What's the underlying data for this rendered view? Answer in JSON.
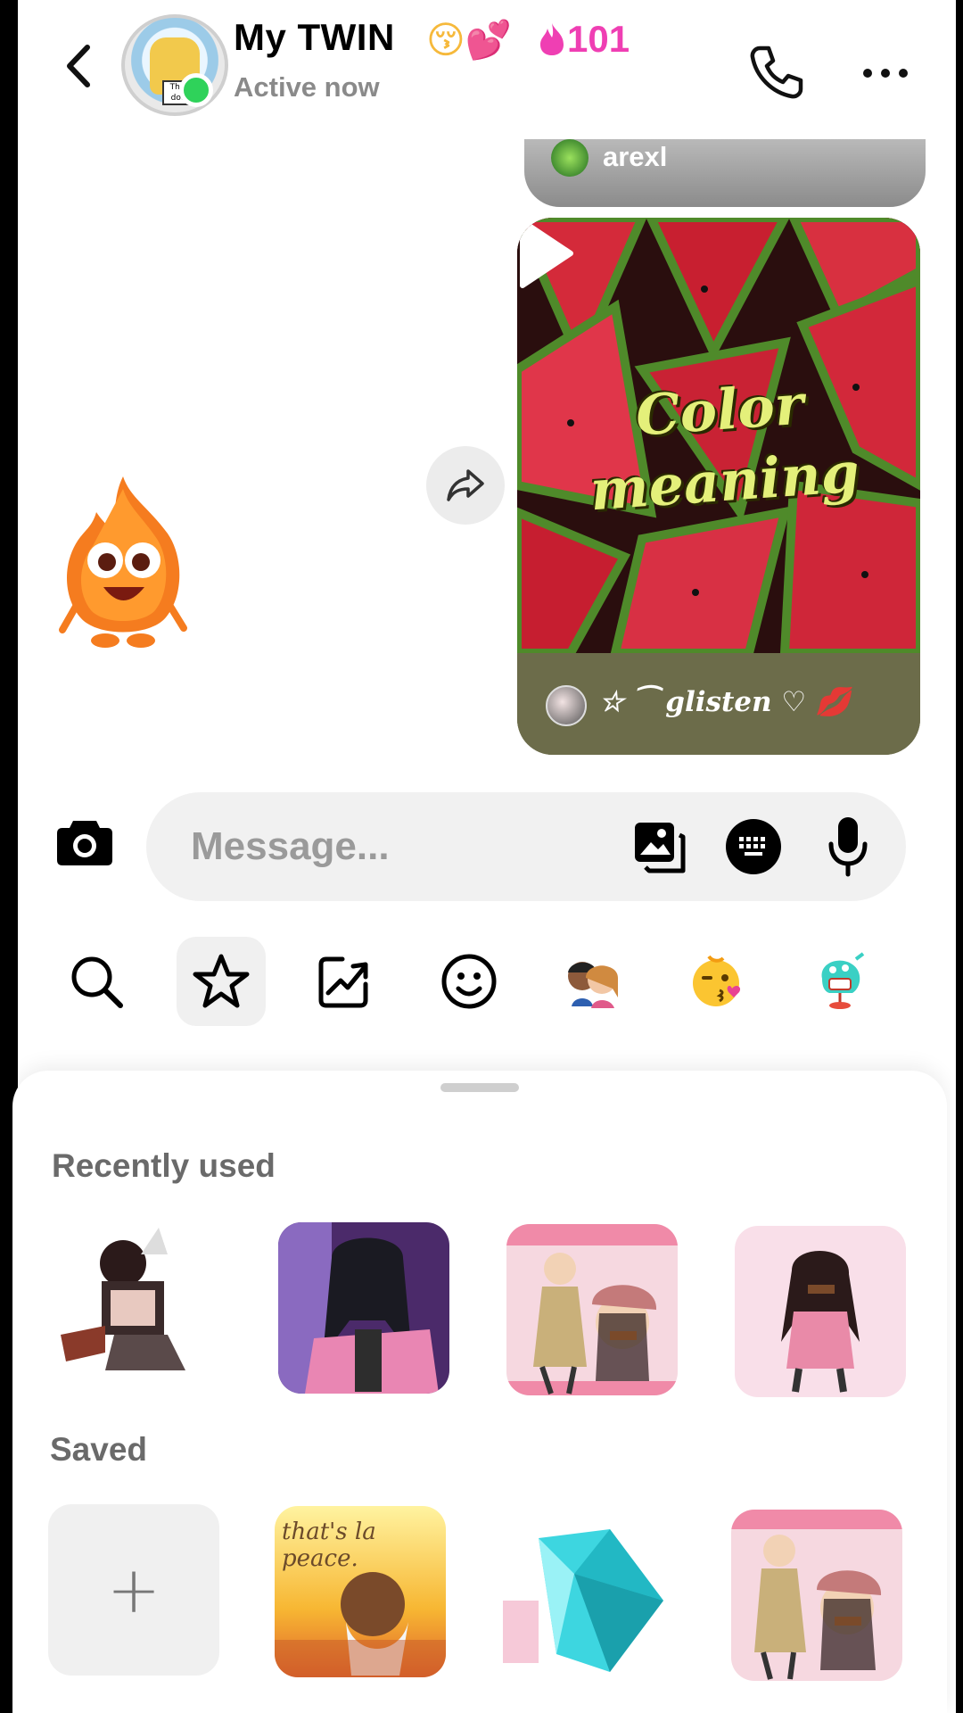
{
  "header": {
    "contact_name": "My TWIN",
    "contact_emoji": "😚💕",
    "streak_count": "101",
    "status": "Active now",
    "icons": [
      "back-icon",
      "phone-icon",
      "more-icon"
    ]
  },
  "messages": {
    "reply_username": "arexl",
    "video_title": "Color meaning",
    "video_caption": "☆ ⁀ glisten ♡ 💋",
    "share_icon": "share-icon",
    "play_icon": "play-icon",
    "sticker": "fire-mascot"
  },
  "composer": {
    "placeholder": "Message...",
    "icons": [
      "camera-icon",
      "gallery-icon",
      "keyboard-icon",
      "microphone-icon"
    ]
  },
  "sticker_tabs": [
    "search-icon",
    "star-icon",
    "trending-icon",
    "smiley-icon",
    "avatars-icon",
    "kiss-emoji-icon",
    "character-icon"
  ],
  "sticker_sheet": {
    "recently_used_label": "Recently used",
    "saved_label": "Saved",
    "add_label": "+",
    "peace_text": "that's la peace."
  },
  "colors": {
    "accent_pink": "#ef3fb3",
    "online_green": "#2fd25a",
    "composer_bg": "#f1f1f1",
    "caption_bar": "#6c6c4a"
  }
}
